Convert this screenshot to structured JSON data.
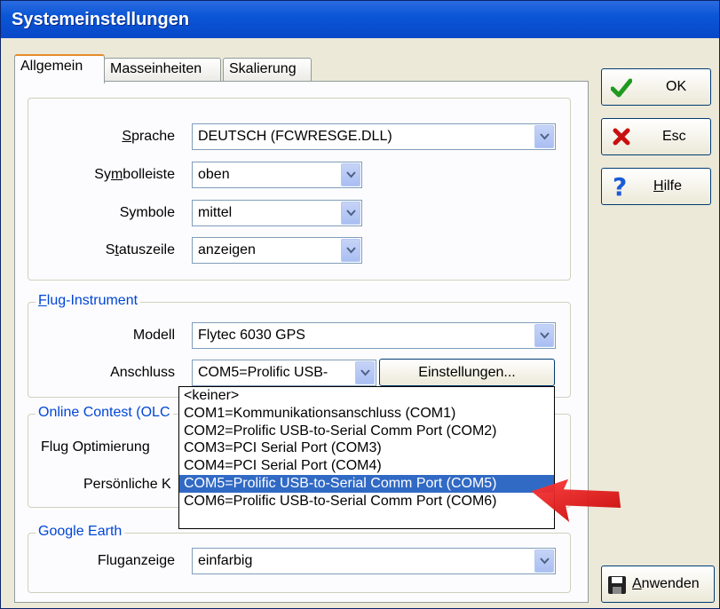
{
  "window": {
    "title": "Systemeinstellungen"
  },
  "tabs": [
    {
      "label": "Allgemein"
    },
    {
      "label": "Masseinheiten"
    },
    {
      "label": "Skalierung"
    }
  ],
  "general": {
    "sprache": {
      "label_pre": "",
      "label_u": "S",
      "label_post": "prache",
      "value": "DEUTSCH  (FCWRESGE.DLL)"
    },
    "symbolleiste": {
      "label_pre": "Sy",
      "label_u": "m",
      "label_post": "bolleiste",
      "value": "oben"
    },
    "symbole": {
      "label": "Symbole",
      "value": "mittel"
    },
    "statuszeile": {
      "label_pre": "S",
      "label_u": "t",
      "label_post": "atuszeile",
      "value": "anzeigen"
    }
  },
  "flug_instrument": {
    "legend_u": "F",
    "legend_post": "lug-Instrument",
    "modell": {
      "label": "Modell",
      "value": "Flytec 6030 GPS"
    },
    "anschluss": {
      "label": "Anschluss",
      "value": "COM5=Prolific USB-"
    },
    "einstellungen_button": "Einstellungen..."
  },
  "online_contest": {
    "legend": "Online Contest (OLC",
    "flug_optimierung_label": "Flug Optimierung",
    "persoenliche_label": "Persönliche K"
  },
  "google_earth": {
    "legend": "Google Earth",
    "fluganzeige": {
      "label": "Fluganzeige",
      "value": "einfarbig"
    }
  },
  "port_dropdown": {
    "options": [
      "<keiner>",
      "COM1=Kommunikationsanschluss (COM1)",
      "COM2=Prolific USB-to-Serial Comm Port (COM2)",
      "COM3=PCI Serial Port (COM3)",
      "COM4=PCI Serial Port (COM4)",
      "COM5=Prolific USB-to-Serial Comm Port (COM5)",
      "COM6=Prolific USB-to-Serial Comm Port (COM6)"
    ],
    "selected_index": 5
  },
  "buttons": {
    "ok": "OK",
    "esc": "Esc",
    "hilfe_u": "H",
    "hilfe_post": "ilfe",
    "anwenden_u": "A",
    "anwenden_post": "nwenden"
  },
  "colors": {
    "selection": "#316ac5",
    "arrow": "#e01010",
    "titlebar": "#0a56d6"
  }
}
